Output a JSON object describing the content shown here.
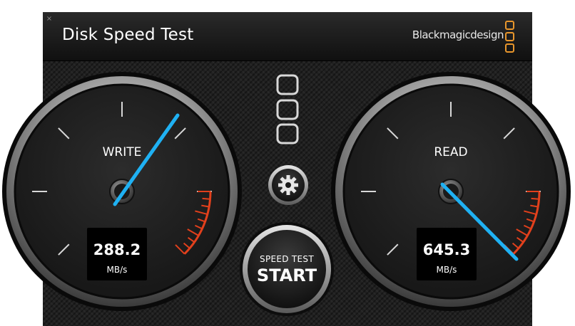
{
  "window": {
    "title": "Disk Speed Test",
    "brand": "Blackmagicdesign",
    "close_glyph": "×"
  },
  "write_gauge": {
    "label": "WRITE",
    "value": "288.2",
    "unit": "MB/s"
  },
  "read_gauge": {
    "label": "READ",
    "value": "645.3",
    "unit": "MB/s"
  },
  "start_button": {
    "top_label": "SPEED TEST",
    "main_label": "START"
  },
  "settings_button": {
    "icon": "gear-icon"
  },
  "colors": {
    "needle": "#1fb1f3",
    "redline": "#e2401c",
    "brand_orange": "#e8962c"
  }
}
